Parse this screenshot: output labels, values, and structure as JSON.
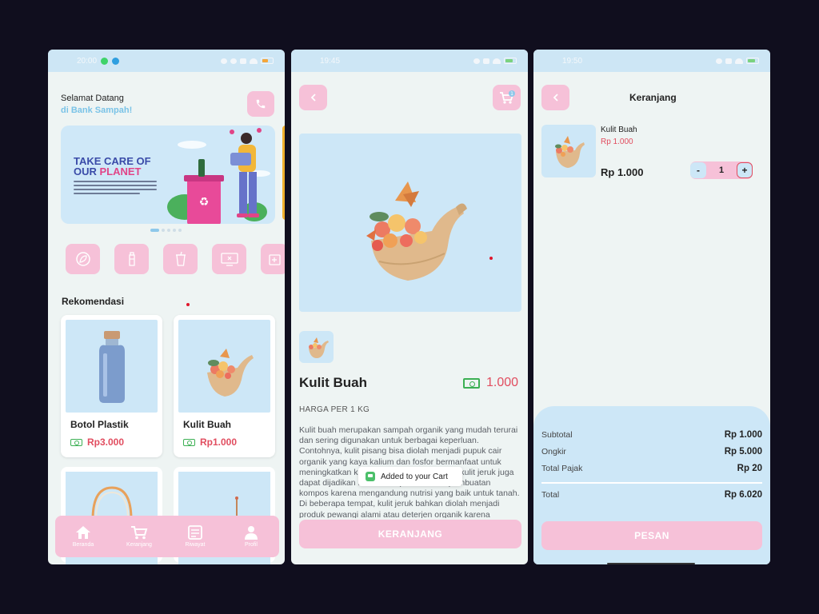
{
  "home": {
    "status_time": "20:00",
    "greeting_line1": "Selamat Datang",
    "greeting_line2": "di Bank Sampah!",
    "banner": {
      "title_line1": "TAKE CARE OF",
      "title_line2_a": "OUR ",
      "title_line2_b": "PLANET"
    },
    "section_title": "Rekomendasi",
    "products": [
      {
        "name": "Botol Plastik",
        "price": "Rp3.000"
      },
      {
        "name": "Kulit Buah",
        "price": "Rp1.000"
      }
    ],
    "nav": [
      {
        "label": "Beranda",
        "icon": "home-icon"
      },
      {
        "label": "Keranjang",
        "icon": "cart-icon"
      },
      {
        "label": "Riwayat",
        "icon": "history-icon"
      },
      {
        "label": "Profil",
        "icon": "person-icon"
      }
    ]
  },
  "detail": {
    "status_time": "19:45",
    "cart_badge": "1",
    "name": "Kulit Buah",
    "price": "1.000",
    "unit": "HARGA PER 1 KG",
    "description": "Kulit buah merupakan sampah organik yang mudah terurai dan sering digunakan untuk berbagai keperluan. Contohnya, kulit pisang bisa diolah menjadi pupuk cair organik yang kaya kalium dan fosfor bermanfaat untuk meningkatkan kesuburan tanah. Selain itu, kulit jeruk juga dapat dijadikan bahan campuran dalam pembuatan kompos karena mengandung nutrisi yang baik untuk tanah. Di beberapa tempat, kulit jeruk bahkan diolah menjadi produk pewangi alami atau deterjen organik karena",
    "toast": "Added to your Cart",
    "button": "KERANJANG"
  },
  "cart": {
    "status_time": "19:50",
    "title": "Keranjang",
    "item": {
      "name": "Kulit Buah",
      "unit_price": "Rp 1.000",
      "total": "Rp 1.000",
      "qty": "1"
    },
    "summary": {
      "subtotal_label": "Subtotal",
      "subtotal": "Rp 1.000",
      "shipping_label": "Ongkir",
      "shipping": "Rp 5.000",
      "tax_label": "Total Pajak",
      "tax": "Rp 20",
      "total_label": "Total",
      "total": "Rp 6.020"
    },
    "button": "PESAN"
  },
  "colors": {
    "accent_pink": "#f6c1d8",
    "light_blue": "#cde7f7",
    "price_red": "#e14d5f",
    "money_green": "#3cb054"
  }
}
